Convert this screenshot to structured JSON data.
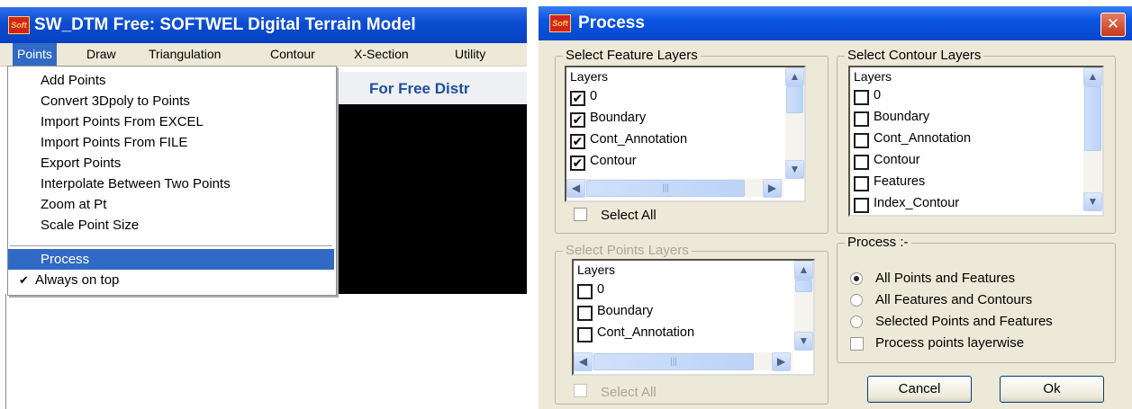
{
  "app_window": {
    "title": "SW_DTM Free: SOFTWEL Digital Terrain Model",
    "logo_text": "Soft",
    "menus": [
      "Points",
      "Draw",
      "Triangulation",
      "Contour",
      "X-Section",
      "Utility"
    ],
    "active_menu": "Points",
    "points_menu": {
      "items": [
        "Add Points",
        "Convert 3Dpoly to Points",
        "Import Points From EXCEL",
        "Import Points From FILE",
        "Export Points",
        "Interpolate Between Two Points",
        "Zoom at Pt",
        "Scale Point Size"
      ],
      "process_label": "Process",
      "always_on_top_label": "Always on top",
      "check_mark": "✔"
    },
    "banner_text": "For Free Distr"
  },
  "dialog": {
    "title": "Process",
    "close_glyph": "✕",
    "feature_layers": {
      "group_title": "Select Feature Layers",
      "header": "Layers",
      "rows": [
        {
          "label": "0",
          "mark": "✔"
        },
        {
          "label": "Boundary",
          "mark": "✔"
        },
        {
          "label": "Cont_Annotation",
          "mark": "✔"
        },
        {
          "label": "Contour",
          "mark": "✔"
        }
      ],
      "select_all_label": "Select All"
    },
    "contour_layers": {
      "group_title": "Select Contour Layers",
      "header": "Layers",
      "rows": [
        {
          "label": "0"
        },
        {
          "label": "Boundary"
        },
        {
          "label": "Cont_Annotation"
        },
        {
          "label": "Contour"
        },
        {
          "label": "Features"
        },
        {
          "label": "Index_Contour"
        }
      ]
    },
    "points_layers": {
      "group_title": "Select Points Layers",
      "header": "Layers",
      "rows": [
        {
          "label": "0"
        },
        {
          "label": "Boundary"
        },
        {
          "label": "Cont_Annotation"
        }
      ],
      "select_all_label": "Select All"
    },
    "process": {
      "group_title": "Process :-",
      "options": [
        "All Points and Features",
        "All Features and Contours",
        "Selected Points and Features"
      ],
      "selected_option": "All Points and Features",
      "layerwise_label": "Process points layerwise"
    },
    "buttons": {
      "cancel": "Cancel",
      "ok": "Ok"
    },
    "scroll_glyphs": {
      "up": "▲",
      "down": "▼",
      "left": "◀",
      "right": "▶",
      "grip": "|||"
    }
  }
}
